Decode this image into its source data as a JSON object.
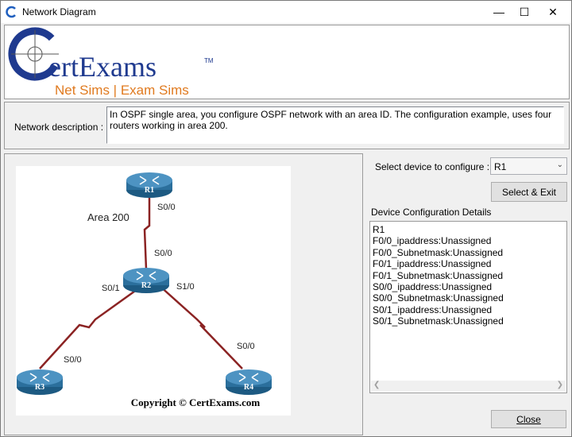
{
  "window": {
    "title": "Network Diagram",
    "minimize_glyph": "—",
    "maximize_glyph": "☐",
    "close_glyph": "✕"
  },
  "logo": {
    "brand_c": "C",
    "brand_rest": "ertExams",
    "tm": "TM",
    "tagline": "Net Sims | Exam Sims",
    "brand_color": "#1f3a8f",
    "tagline_color": "#e07a1f"
  },
  "description": {
    "label": "Network description :",
    "text": "In OSPF single area, you configure OSPF network with an area ID. The configuration example, uses four routers working in area 200."
  },
  "diagram": {
    "area_label": "Area 200",
    "routers": [
      "R1",
      "R2",
      "R3",
      "R4"
    ],
    "interfaces": {
      "r1_s00": "S0/0",
      "r2_s00": "S0/0",
      "r2_s01": "S0/1",
      "r2_s10": "S1/0",
      "r3_s00": "S0/0",
      "r4_s00": "S0/0"
    },
    "copyright": "Copyright © CertExams.com",
    "link_color": "#8b2323",
    "router_color": "#2b6f9c"
  },
  "device_select": {
    "label": "Select device to configure :",
    "selected": "R1"
  },
  "buttons": {
    "select_exit": "Select & Exit",
    "close": "Close"
  },
  "details": {
    "label": "Device Configuration Details",
    "lines": [
      "R1",
      "F0/0_ipaddress:Unassigned",
      "F0/0_Subnetmask:Unassigned",
      "F0/1_ipaddress:Unassigned",
      "F0/1_Subnetmask:Unassigned",
      "S0/0_ipaddress:Unassigned",
      "S0/0_Subnetmask:Unassigned",
      "S0/1_ipaddress:Unassigned",
      "S0/1_Subnetmask:Unassigned"
    ]
  }
}
